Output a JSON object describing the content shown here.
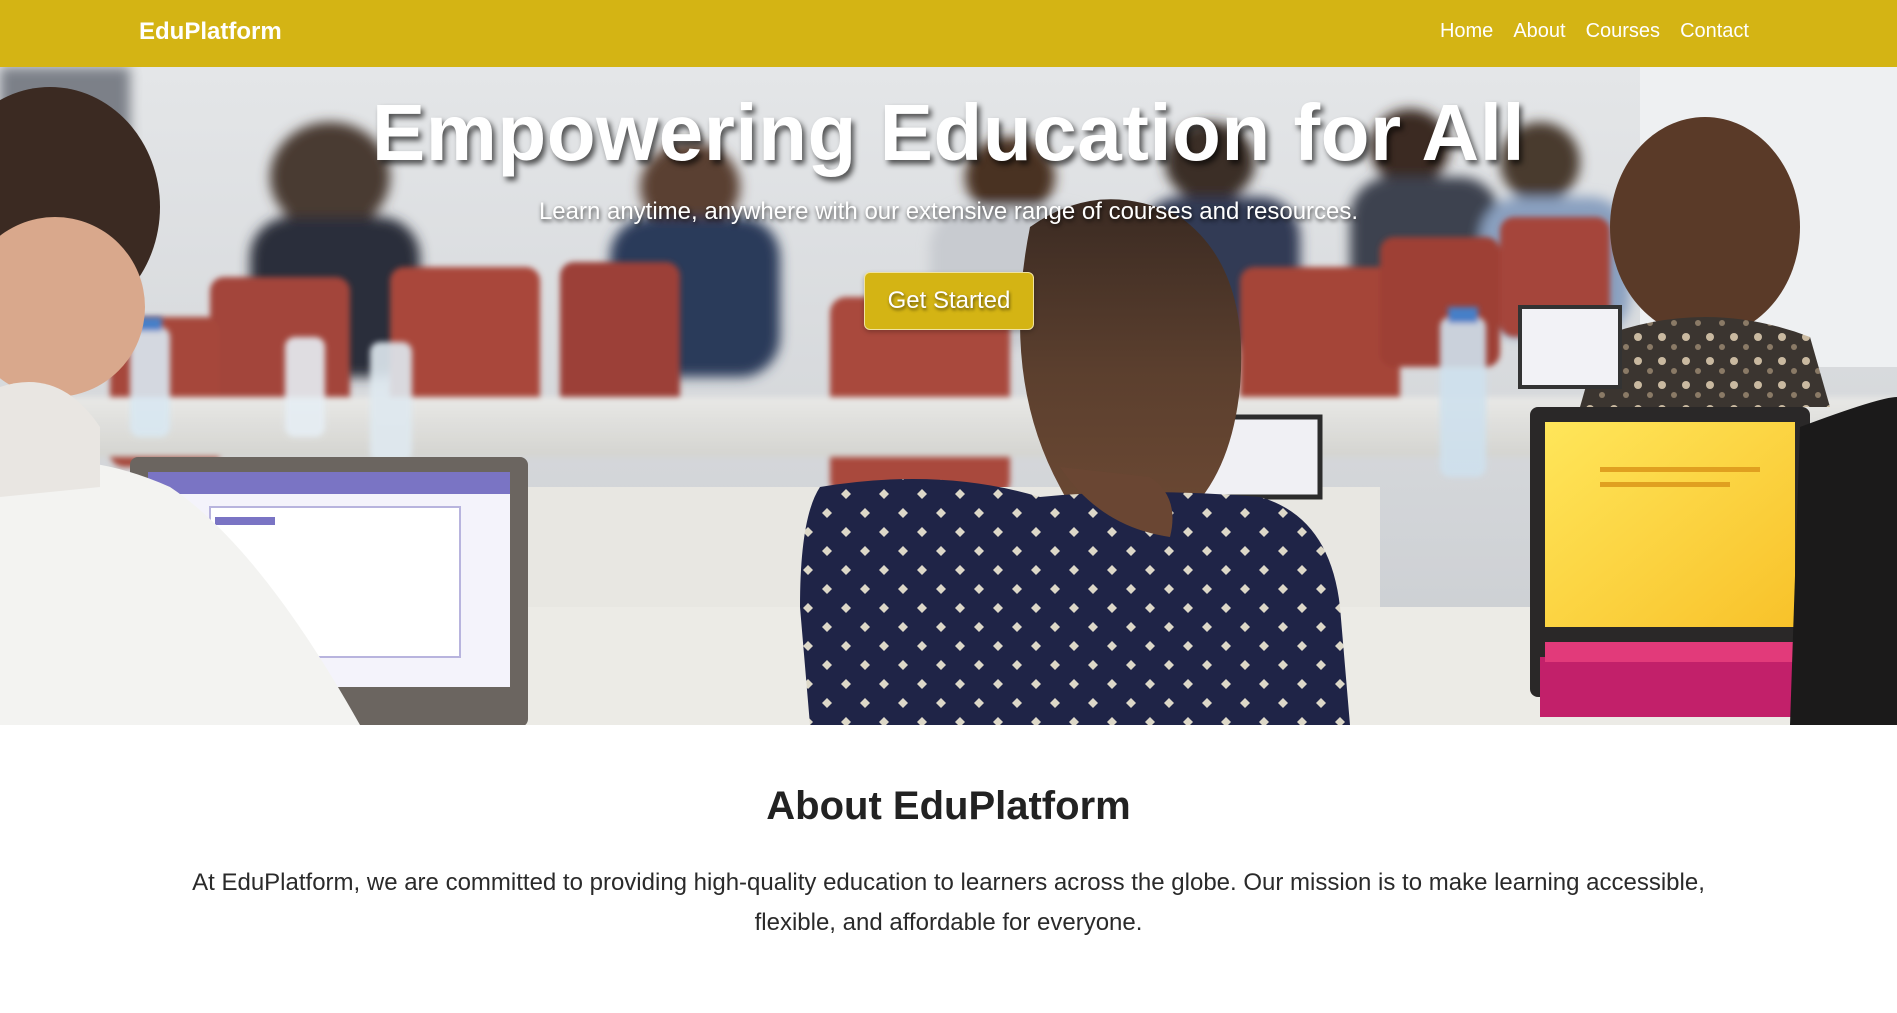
{
  "navbar": {
    "brand": "EduPlatform",
    "links": [
      {
        "label": "Home"
      },
      {
        "label": "About"
      },
      {
        "label": "Courses"
      },
      {
        "label": "Contact"
      }
    ],
    "background_color": "#d4b414"
  },
  "hero": {
    "title": "Empowering Education for All",
    "subtitle": "Learn anytime, anywhere with our extensive range of courses and resources.",
    "cta_label": "Get Started",
    "image_description": "classroom-with-students-on-laptops-photo"
  },
  "about": {
    "heading": "About EduPlatform",
    "text": "At EduPlatform, we are committed to providing high-quality education to learners across the globe. Our mission is to make learning accessible, flexible, and affordable for everyone."
  },
  "colors": {
    "accent": "#d4b414",
    "text_dark": "#222222",
    "text_light": "#ffffff"
  }
}
